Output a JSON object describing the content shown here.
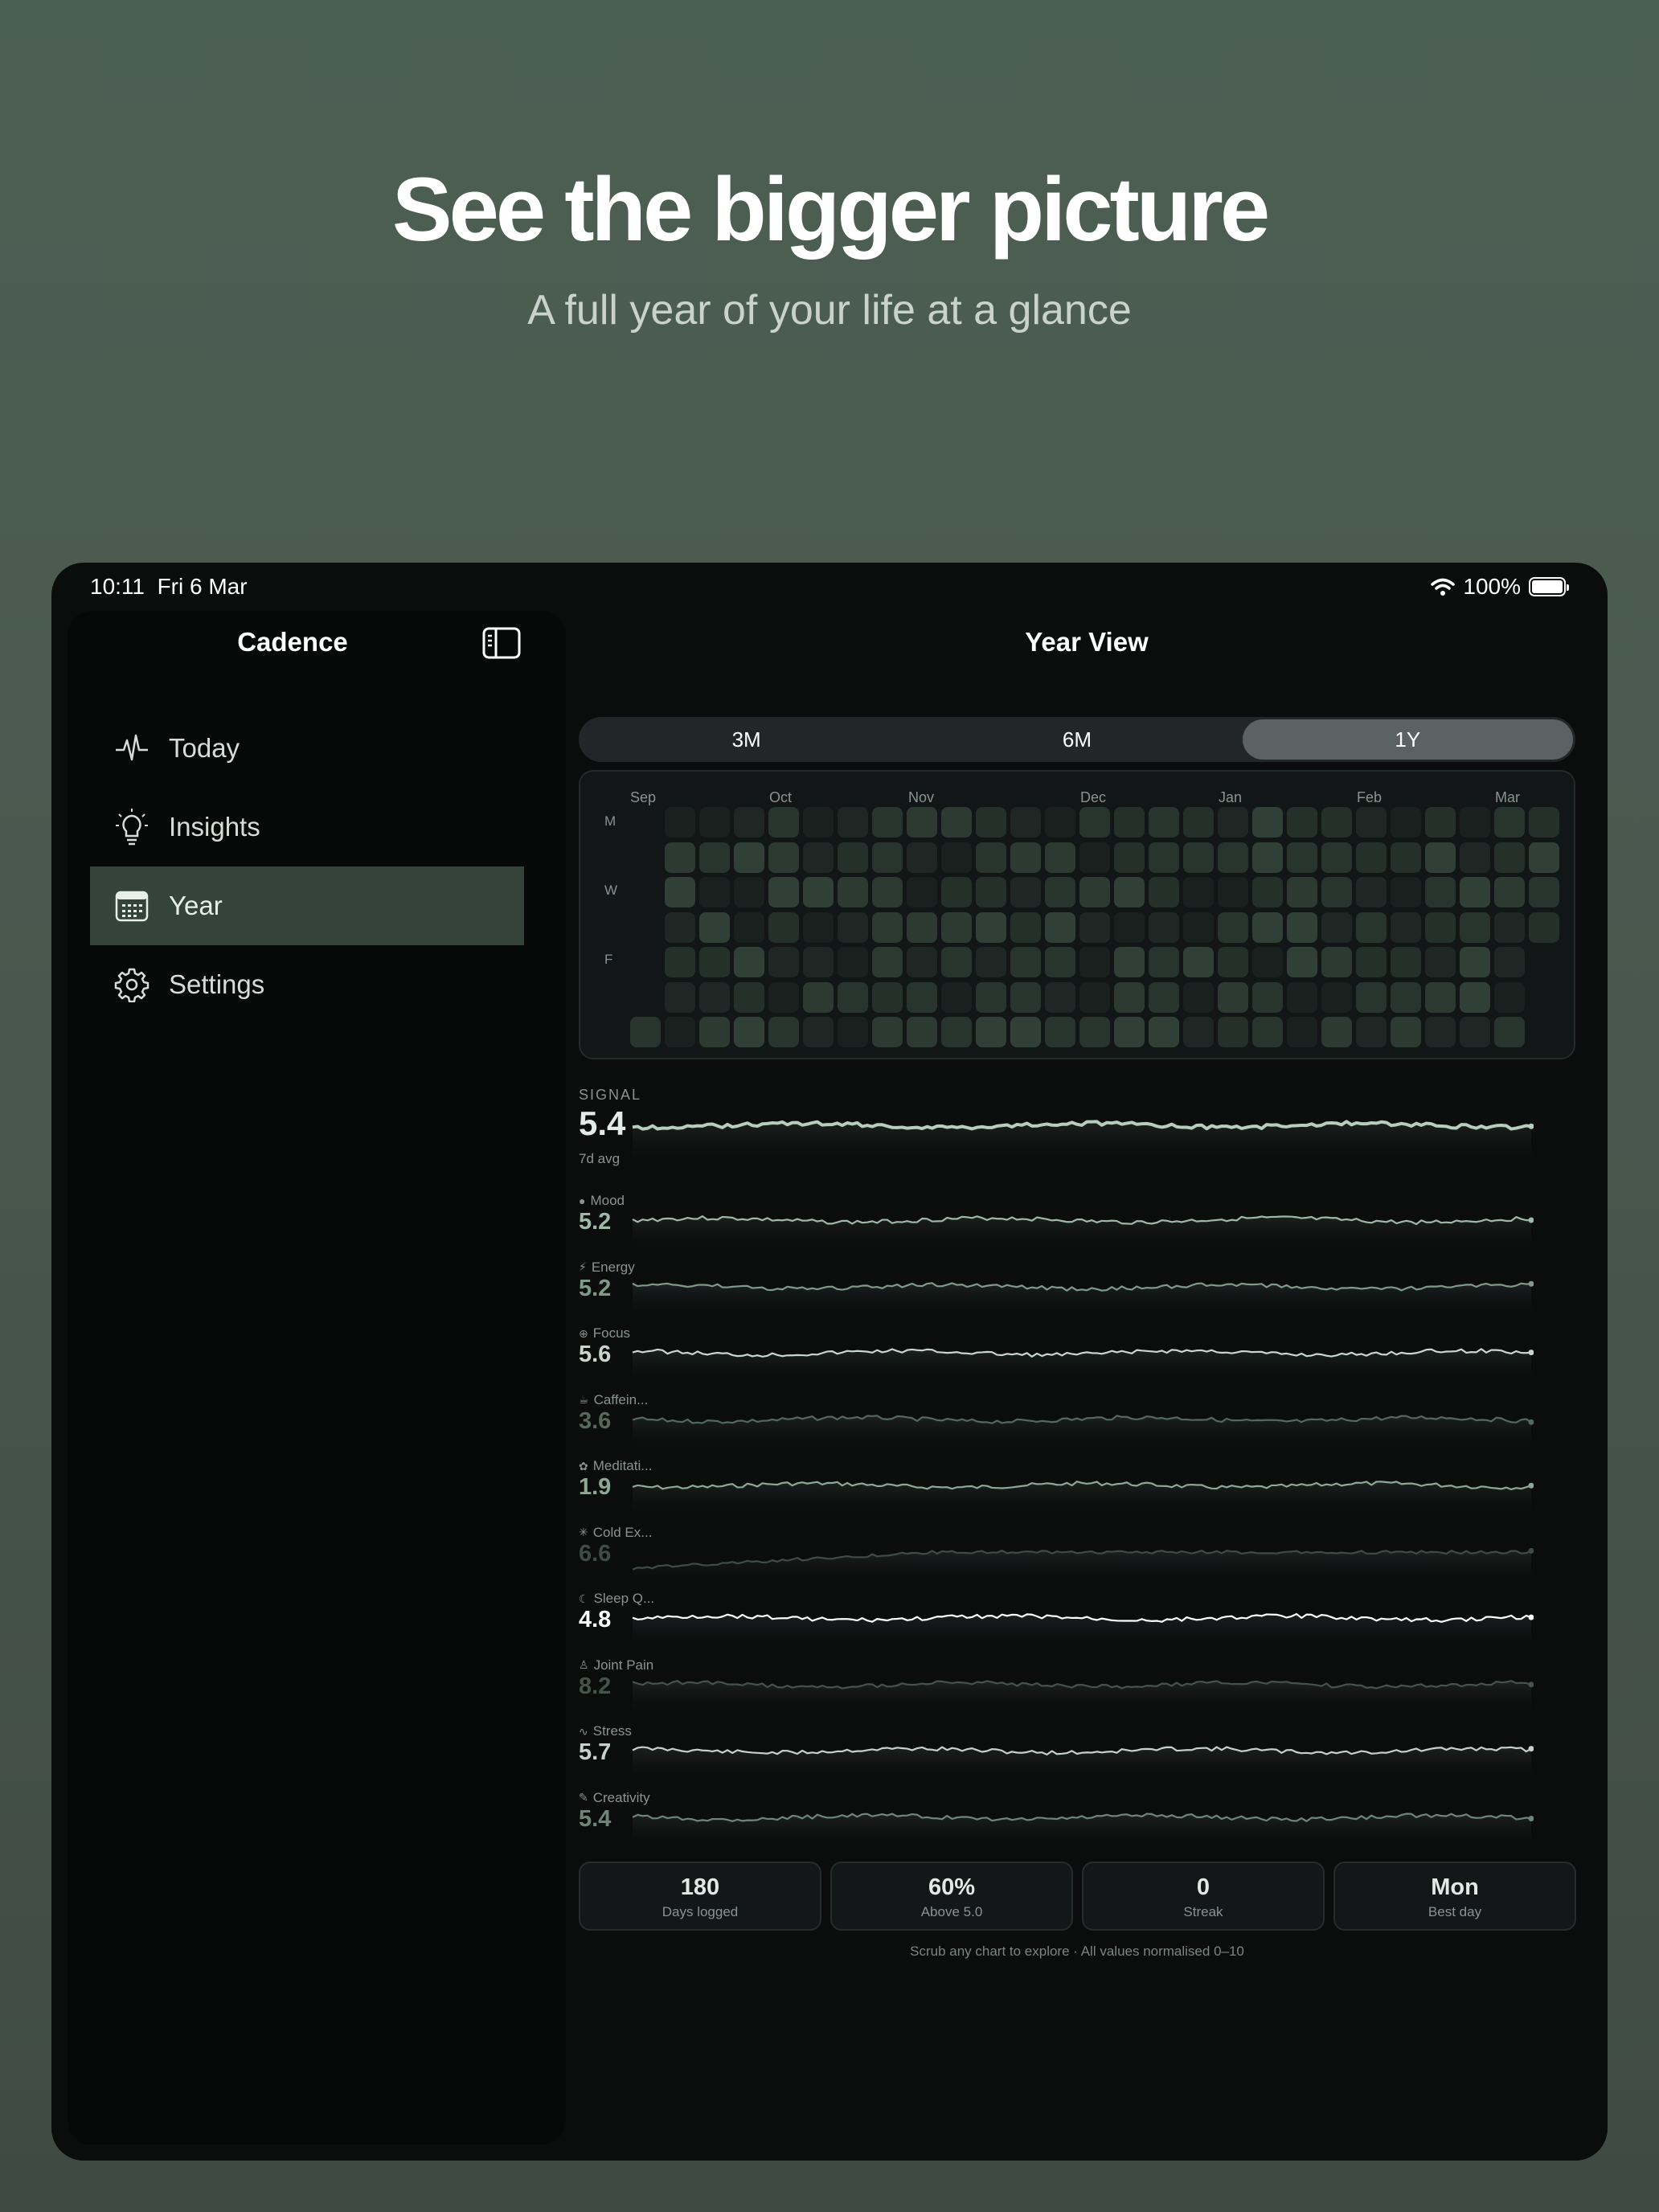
{
  "hero": {
    "title": "See the bigger picture",
    "subtitle": "A full year of your life at a glance"
  },
  "status_bar": {
    "time": "10:11",
    "date": "Fri 6 Mar",
    "battery": "100%"
  },
  "sidebar": {
    "title": "Cadence",
    "items": [
      {
        "label": "Today",
        "icon": "waveform-icon",
        "active": false
      },
      {
        "label": "Insights",
        "icon": "lightbulb-icon",
        "active": false
      },
      {
        "label": "Year",
        "icon": "calendar-icon",
        "active": true
      },
      {
        "label": "Settings",
        "icon": "gear-icon",
        "active": false
      }
    ]
  },
  "main": {
    "title": "Year View",
    "ranges": [
      {
        "label": "3M",
        "active": false
      },
      {
        "label": "6M",
        "active": false
      },
      {
        "label": "1Y",
        "active": true
      }
    ],
    "heatmap": {
      "months": [
        "Sep",
        "Oct",
        "Nov",
        "Dec",
        "Jan",
        "Feb",
        "Mar"
      ],
      "days": [
        "M",
        "W",
        "F"
      ]
    },
    "signal": {
      "caption": "SIGNAL",
      "value": "5.4",
      "sub": "7d avg"
    },
    "metrics": [
      {
        "name": "Mood",
        "value": "5.2",
        "icon": "circle-icon",
        "color": "#9fb9a8"
      },
      {
        "name": "Energy",
        "value": "5.2",
        "icon": "bolt-icon",
        "color": "#7f9a89"
      },
      {
        "name": "Focus",
        "value": "5.6",
        "icon": "target-icon",
        "color": "#c9d6ce"
      },
      {
        "name": "Caffein...",
        "value": "3.6",
        "icon": "cup-icon",
        "color": "#55685c"
      },
      {
        "name": "Meditati...",
        "value": "1.9",
        "icon": "lotus-icon",
        "color": "#8ea796"
      },
      {
        "name": "Cold Ex...",
        "value": "6.6",
        "icon": "snowflake-icon",
        "color": "#3f4c45"
      },
      {
        "name": "Sleep Q...",
        "value": "4.8",
        "icon": "moon-icon",
        "color": "#ffffff"
      },
      {
        "name": "Joint Pain",
        "value": "8.2",
        "icon": "figure-icon",
        "color": "#45544b"
      },
      {
        "name": "Stress",
        "value": "5.7",
        "icon": "pulse-icon",
        "color": "#c7d1cb"
      },
      {
        "name": "Creativity",
        "value": "5.4",
        "icon": "brush-icon",
        "color": "#6f857a"
      }
    ],
    "stats": [
      {
        "value": "180",
        "label": "Days logged"
      },
      {
        "value": "60%",
        "label": "Above 5.0"
      },
      {
        "value": "0",
        "label": "Streak"
      },
      {
        "value": "Mon",
        "label": "Best day"
      }
    ],
    "footer_note": "Scrub any chart to explore · All values normalised 0–10"
  }
}
